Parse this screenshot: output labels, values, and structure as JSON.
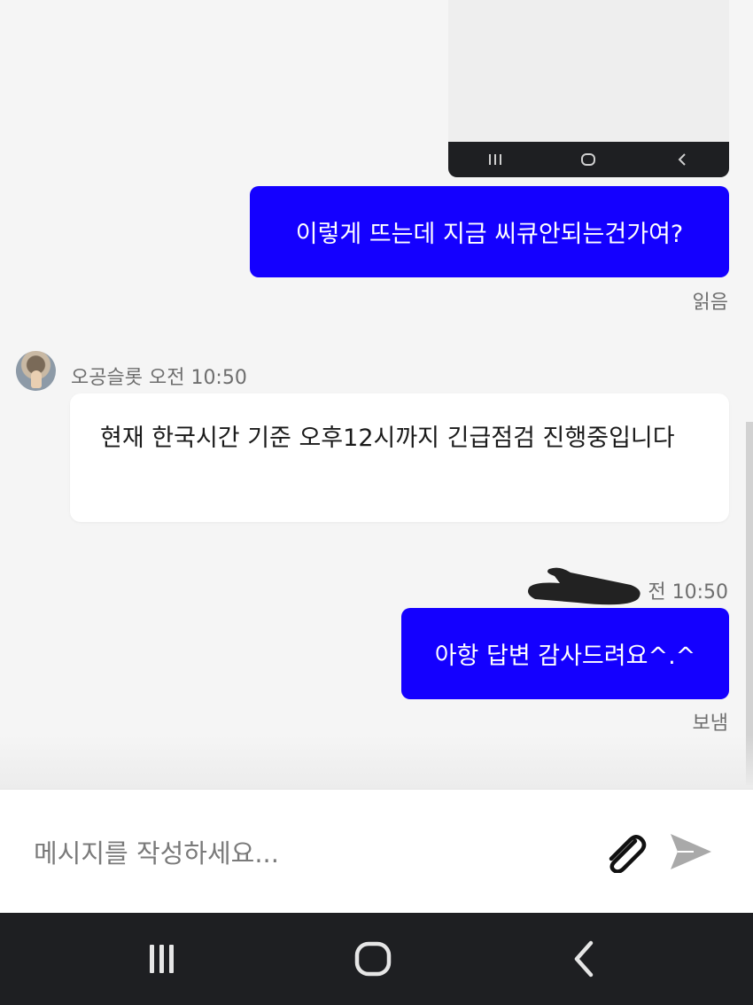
{
  "messages": [
    {
      "id": "out1",
      "text": "이렇게 뜨는데 지금 씨큐안되는건가여?",
      "status": "읽음"
    },
    {
      "id": "in1",
      "sender": "오공슬롯",
      "time": "오전 10:50",
      "text": "현재 한국시간 기준 오후12시까지 긴급점검 진행중입니다"
    },
    {
      "id": "out2",
      "time_partial": "전 10:50",
      "text": "아항 답변 감사드려요^.^",
      "status": "보냄"
    }
  ],
  "composer": {
    "placeholder": "메시지를 작성하세요..."
  },
  "icons": {
    "attach": "paperclip-icon",
    "send": "send-icon",
    "nav_recents": "recents-icon",
    "nav_home": "home-icon",
    "nav_back": "back-icon"
  },
  "colors": {
    "outgoing_bubble": "#1400ff",
    "incoming_bubble": "#ffffff",
    "background": "#f5f5f5",
    "nav_bar": "#1e1f22"
  }
}
